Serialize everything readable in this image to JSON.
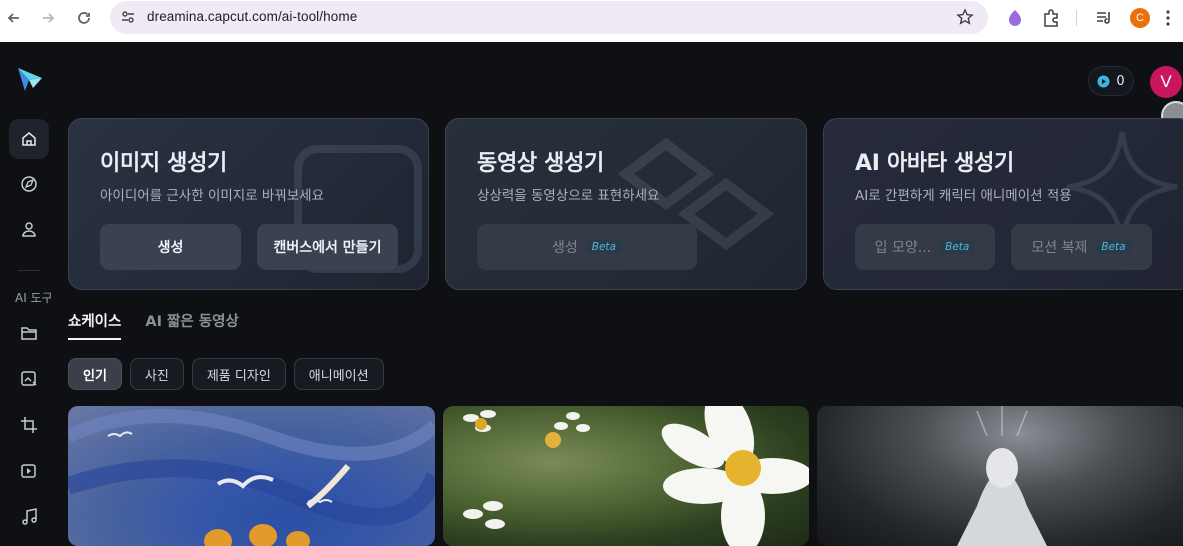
{
  "browser": {
    "url": "dreamina.capcut.com/ai-tool/home",
    "profile_initial": "C"
  },
  "header": {
    "credits": "0",
    "avatar_initial": "V"
  },
  "sidebar": {
    "section_label": "AI 도구",
    "items": [
      {
        "icon": "home-icon",
        "active": true
      },
      {
        "icon": "explore-icon",
        "active": false
      },
      {
        "icon": "user-icon",
        "active": false
      },
      {
        "icon": "folder-icon",
        "active": false
      },
      {
        "icon": "image-edit-icon",
        "active": false
      },
      {
        "icon": "crop-icon",
        "active": false
      },
      {
        "icon": "video-play-icon",
        "active": false
      },
      {
        "icon": "music-icon",
        "active": false
      }
    ]
  },
  "cards": [
    {
      "title": "이미지 생성기",
      "subtitle": "아이디어를 근사한 이미지로 바꿔보세요",
      "buttons": [
        {
          "label": "생성",
          "beta": false
        },
        {
          "label": "캔버스에서 만들기",
          "beta": false
        }
      ]
    },
    {
      "title": "동영상 생성기",
      "subtitle": "상상력을 동영상으로 표현하세요",
      "buttons": [
        {
          "label": "생성",
          "beta": true
        }
      ]
    },
    {
      "title": "AI 아바타 생성기",
      "subtitle": "AI로 간편하게 캐릭터 애니메이션 적용",
      "buttons": [
        {
          "label": "입 모양...",
          "beta": true
        },
        {
          "label": "모션 복제",
          "beta": true
        }
      ]
    }
  ],
  "beta_label": "Beta",
  "tabs": [
    {
      "label": "쇼케이스",
      "active": true
    },
    {
      "label": "AI 짧은 동영상",
      "active": false
    }
  ],
  "chips": [
    {
      "label": "인기",
      "active": true
    },
    {
      "label": "사진",
      "active": false
    },
    {
      "label": "제품 디자인",
      "active": false
    },
    {
      "label": "애니메이션",
      "active": false
    }
  ],
  "colors": {
    "background": "#0e1014",
    "avatar": "#c8175f",
    "beta_text": "#4fb6d2",
    "profile_badge": "#e8710a"
  }
}
